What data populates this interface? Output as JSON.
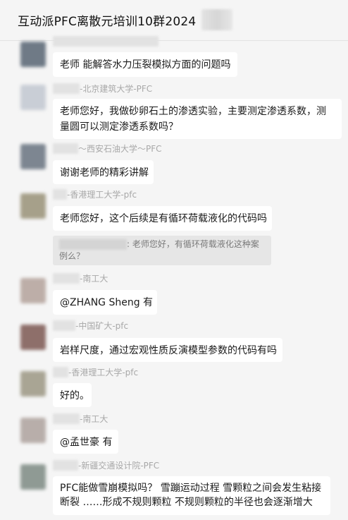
{
  "header": {
    "title": "互动派PFC离散元培训10群2024"
  },
  "messages": [
    {
      "sender": "",
      "text": "老师 能解答水力压裂模拟方面的问题吗",
      "avatar_color": "#6f7a86"
    },
    {
      "sender": "-北京建筑大学-PFC",
      "text": "老师您好，我做砂卵石土的渗透实验，主要测定渗透系数，测量圆可以测定渗透系数吗？",
      "avatar_color": "#c9ced6"
    },
    {
      "sender": "～西安石油大学～PFC",
      "text": "谢谢老师的精彩讲解",
      "avatar_color": "#7d8691"
    },
    {
      "sender": "-香港理工大学-pfc",
      "text": "老师您好，这个后续是有循环荷载液化的代码吗",
      "avatar_color": "#a6a08a",
      "quote": ": 老师您好，有循环荷载液化这种案例么？"
    },
    {
      "sender": "-南工大",
      "text": "@ZHANG Sheng 有",
      "avatar_color": "#bdaea8"
    },
    {
      "sender": "-中国矿大-pfc",
      "text": "岩样尺度，通过宏观性质反演模型参数的代码有吗",
      "avatar_color": "#8e6f6a"
    },
    {
      "sender": "-香港理工大学-pfc",
      "text": "好的。",
      "avatar_color": "#a9a594"
    },
    {
      "sender": "-南工大",
      "text": "@孟世豪 有",
      "avatar_color": "#b8aeaa"
    },
    {
      "sender": "-新疆交通设计院-PFC",
      "text": "PFC能做雪崩模拟吗？  雪蹦运动过程 雪颗粒之间会发生粘接 断裂 ……形成不规则颗粒  不规则颗粒的半径也会逐渐增大",
      "avatar_color": "#8f9a94"
    }
  ]
}
